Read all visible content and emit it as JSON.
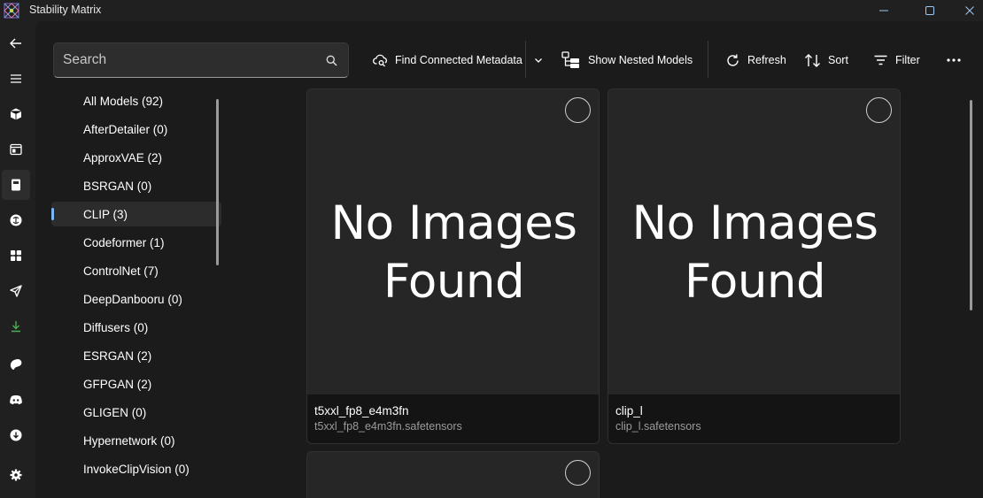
{
  "window": {
    "title": "Stability Matrix",
    "minimize_icon": "minimize-icon",
    "maximize_icon": "maximize-icon",
    "close_icon": "close-icon"
  },
  "nav_rail": {
    "items": [
      {
        "icon": "back-arrow-icon"
      },
      {
        "icon": "hamburger-menu-icon"
      },
      {
        "icon": "package-box-icon"
      },
      {
        "icon": "inference-window-icon"
      },
      {
        "icon": "checkpoint-manager-icon",
        "active": true
      },
      {
        "icon": "civitai-brain-icon"
      },
      {
        "icon": "apps-grid-icon"
      },
      {
        "icon": "workflow-send-icon"
      },
      {
        "icon": "download-icon"
      },
      {
        "icon": "patreon-icon"
      },
      {
        "icon": "discord-icon"
      },
      {
        "icon": "update-download-icon"
      },
      {
        "icon": "settings-gear-icon"
      }
    ]
  },
  "search": {
    "placeholder": "Search"
  },
  "toolbar": {
    "find_metadata_label": "Find Connected Metadata",
    "show_nested_label": "Show Nested Models",
    "refresh_label": "Refresh",
    "sort_label": "Sort",
    "filter_label": "Filter"
  },
  "categories": [
    {
      "label": "All Models (92)"
    },
    {
      "label": "AfterDetailer (0)"
    },
    {
      "label": "ApproxVAE (2)"
    },
    {
      "label": "BSRGAN (0)"
    },
    {
      "label": "CLIP (3)",
      "selected": true
    },
    {
      "label": "Codeformer (1)"
    },
    {
      "label": "ControlNet (7)"
    },
    {
      "label": "DeepDanbooru (0)"
    },
    {
      "label": "Diffusers (0)"
    },
    {
      "label": "ESRGAN (2)"
    },
    {
      "label": "GFPGAN (2)"
    },
    {
      "label": "GLIGEN (0)"
    },
    {
      "label": "Hypernetwork (0)"
    },
    {
      "label": "InvokeClipVision (0)"
    }
  ],
  "cards": [
    {
      "placeholder_line1": "No Images",
      "placeholder_line2": "Found",
      "name": "t5xxl_fp8_e4m3fn",
      "file": "t5xxl_fp8_e4m3fn.safetensors"
    },
    {
      "placeholder_line1": "No Images",
      "placeholder_line2": "Found",
      "name": "clip_l",
      "file": "clip_l.safetensors"
    },
    {
      "placeholder_line1": "",
      "placeholder_line2": "",
      "name": "",
      "file": ""
    }
  ],
  "colors": {
    "accent": "#7ab8f5",
    "background": "#202020",
    "content_background": "#1b1b1b",
    "card_background": "#262626",
    "card_footer": "#141414",
    "download_icon": "#4caf50"
  }
}
